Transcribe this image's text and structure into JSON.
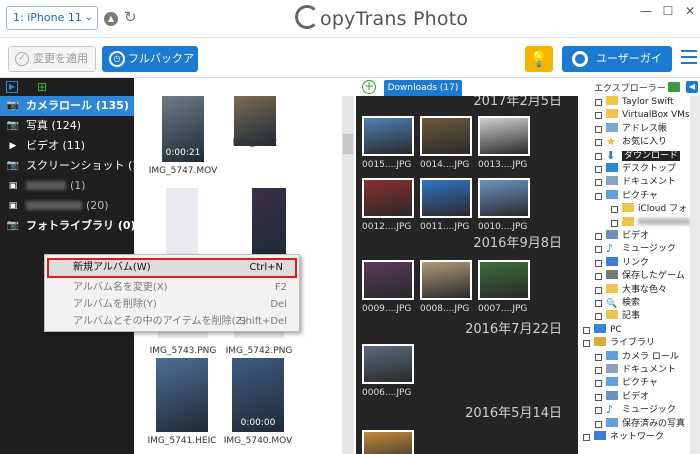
{
  "titlebar": {
    "device": "1: iPhone 11",
    "app_title": "opyTrans Photo",
    "win_controls": [
      "—",
      "☐",
      "✕"
    ]
  },
  "toolbar": {
    "apply_label": "変更を適用",
    "backup_label": "フルバックアップ",
    "guide_label": "ユーザーガイド"
  },
  "albums": [
    {
      "icon": "camera-icon",
      "label": "カメラロール (135)",
      "selected": true,
      "bold": true
    },
    {
      "icon": "camera-icon",
      "label": "写真 (124)"
    },
    {
      "icon": "video-icon",
      "label": "ビデオ (11)"
    },
    {
      "icon": "camera-icon",
      "label": "スクリーンショット (12)"
    },
    {
      "icon": "album-icon",
      "label": "(1)",
      "blurred": true
    },
    {
      "icon": "album-icon",
      "label": "(20)",
      "blurred": true,
      "long": true
    },
    {
      "icon": "camera-icon",
      "label": "フォトライブラリ (0)",
      "bold": true
    }
  ],
  "context_menu": [
    {
      "label": "新規アルバム(W)",
      "shortcut": "Ctrl+N",
      "active": true
    },
    {
      "label": "アルバム名を変更(X)",
      "shortcut": "F2"
    },
    {
      "label": "アルバムを削除(Y)",
      "shortcut": "Del"
    },
    {
      "label": "アルバムとその中のアイテムを削除(Z)",
      "shortcut": "Shift+Del"
    }
  ],
  "photos": [
    {
      "label": "IMG_5747.MOV",
      "duration": "0:00:21",
      "color": "#6f7b86"
    },
    {
      "label": "IMG_7982",
      "color": "#7d6b55"
    },
    {
      "label": "",
      "color": "#e8eaf0"
    },
    {
      "label": "",
      "color": "#3a2e4a"
    },
    {
      "label": "IMG_5743.PNG",
      "color": "#eaeaea"
    },
    {
      "label": "IMG_5742.PNG",
      "color": "#eaeaea"
    },
    {
      "label": "IMG_5741.HEIC",
      "color": "#4f6e95"
    },
    {
      "label": "IMG_5740.MOV",
      "duration": "0:00:00",
      "color": "#3f5c80"
    }
  ],
  "downloads": {
    "tab_label": "Downloads (17)",
    "dates": [
      "2017年2月5日",
      "2016年9月8日",
      "2016年7月22日",
      "2016年5月14日"
    ],
    "items": [
      {
        "label": "0015....JPG",
        "color": "#4e7fb8"
      },
      {
        "label": "0014....JPG",
        "color": "#6a5a3a"
      },
      {
        "label": "0013....JPG",
        "color": "#cfcfcf"
      },
      {
        "label": "0012....JPG",
        "color": "#8a2e2e"
      },
      {
        "label": "0011....JPG",
        "color": "#2f74c7"
      },
      {
        "label": "0010....JPG",
        "color": "#6b94c4"
      },
      {
        "label": "0009....JPG",
        "color": "#5a3a5a"
      },
      {
        "label": "0008....JPG",
        "color": "#b09a7a"
      },
      {
        "label": "0007....JPG",
        "color": "#3b6e3b"
      },
      {
        "label": "0006....JPG",
        "color": "#5b6b7d"
      },
      {
        "label": "",
        "color": "#c08a3a"
      }
    ]
  },
  "explorer": {
    "title": "エクスプローラー",
    "items": [
      {
        "label": "Taylor Swift",
        "icon": "folder-icon",
        "indent": 1
      },
      {
        "label": "VirtualBox VMs",
        "icon": "folder-icon",
        "indent": 1
      },
      {
        "label": "アドレス帳",
        "icon": "contacts-icon",
        "indent": 1
      },
      {
        "label": "お気に入り",
        "icon": "star-icon",
        "indent": 1
      },
      {
        "label": "ダウンロード",
        "icon": "download-icon",
        "indent": 1,
        "selected": true
      },
      {
        "label": "デスクトップ",
        "icon": "desktop-icon",
        "indent": 1
      },
      {
        "label": "ドキュメント",
        "icon": "documents-icon",
        "indent": 1
      },
      {
        "label": "ピクチャ",
        "icon": "pictures-icon",
        "indent": 1
      },
      {
        "label": "iCloud フォト",
        "icon": "folder-icon",
        "indent": 2
      },
      {
        "label": "",
        "icon": "folder-icon",
        "indent": 2,
        "blurred": true
      },
      {
        "label": "ビデオ",
        "icon": "video-folder-icon",
        "indent": 1
      },
      {
        "label": "ミュージック",
        "icon": "music-icon",
        "indent": 1
      },
      {
        "label": "リンク",
        "icon": "link-icon",
        "indent": 1
      },
      {
        "label": "保存したゲーム",
        "icon": "games-icon",
        "indent": 1
      },
      {
        "label": "大事な色々",
        "icon": "folder-icon",
        "indent": 1
      },
      {
        "label": "検索",
        "icon": "search-icon",
        "indent": 1
      },
      {
        "label": "記事",
        "icon": "folder-icon",
        "indent": 1
      },
      {
        "label": "PC",
        "icon": "pc-icon",
        "indent": 0
      },
      {
        "label": "ライブラリ",
        "icon": "library-icon",
        "indent": 0
      },
      {
        "label": "カメラ ロール",
        "icon": "pictures-icon",
        "indent": 1
      },
      {
        "label": "ドキュメント",
        "icon": "documents-icon",
        "indent": 1
      },
      {
        "label": "ピクチャ",
        "icon": "pictures-icon",
        "indent": 1
      },
      {
        "label": "ビデオ",
        "icon": "video-folder-icon",
        "indent": 1
      },
      {
        "label": "ミュージック",
        "icon": "music-icon",
        "indent": 1
      },
      {
        "label": "保存済みの写真",
        "icon": "pictures-icon",
        "indent": 1
      },
      {
        "label": "ネットワーク",
        "icon": "network-icon",
        "indent": 0
      }
    ]
  },
  "colors": {
    "accent": "#1b7bd3",
    "selected_album": "#2f86d8",
    "left_bg": "#1f1f1f",
    "downloads_bg": "#252525",
    "highlight_border": "#e01a1a",
    "bulb": "#f5b400"
  }
}
